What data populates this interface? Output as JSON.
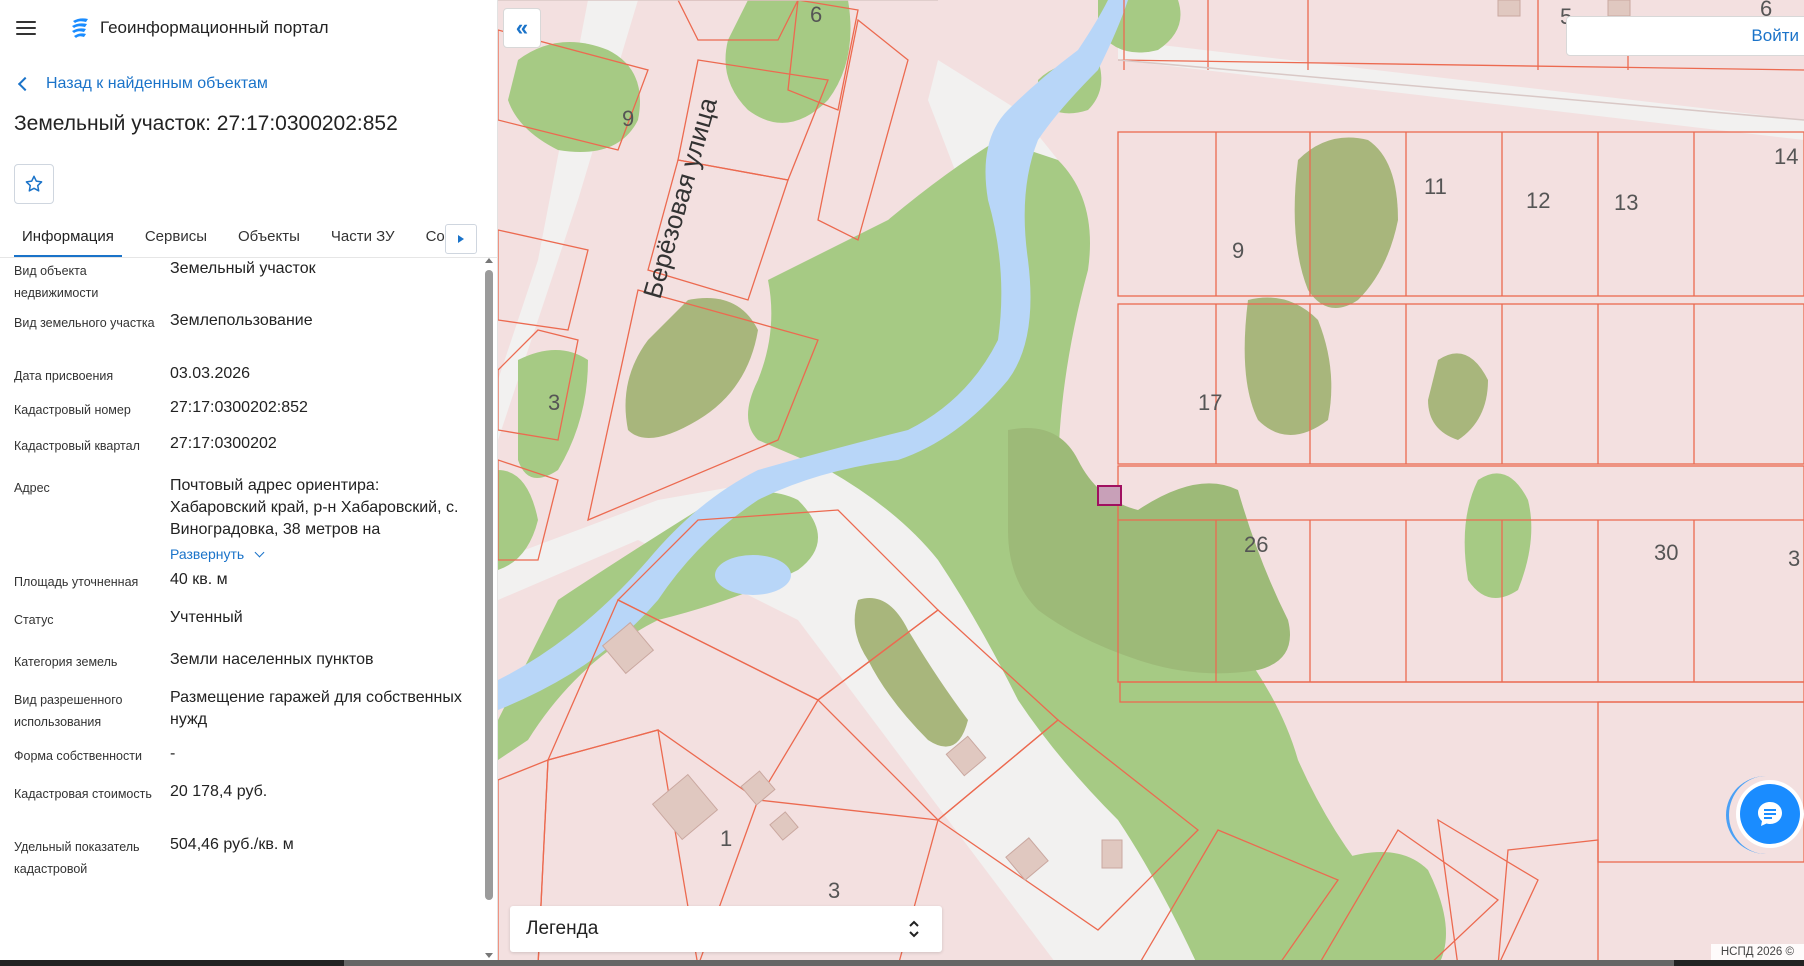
{
  "app": {
    "title": "Геоинформационный портал"
  },
  "panel": {
    "back_label": "Назад к найденным объектам",
    "object_title": "Земельный участок: 27:17:0300202:852",
    "tabs": [
      {
        "label": "Информация",
        "active": true
      },
      {
        "label": "Сервисы"
      },
      {
        "label": "Объекты"
      },
      {
        "label": "Части ЗУ"
      },
      {
        "label": "Состав"
      }
    ],
    "fields": [
      {
        "label": "Вид объекта недвижимости",
        "value": "Земельный участок"
      },
      {
        "label": "Вид земельного участка",
        "value": "Землепользование"
      },
      {
        "label": "Дата присвоения",
        "value": "03.03.2026"
      },
      {
        "label": "Кадастровый номер",
        "value": "27:17:0300202:852"
      },
      {
        "label": "Кадастровый квартал",
        "value": "27:17:0300202"
      },
      {
        "label": "Адрес",
        "value": "Почтовый адрес ориентира: Хабаровский край, р-н Хабаровский, с. Виноградовка, 38 метров на",
        "expand": "Развернуть"
      },
      {
        "label": "Площадь уточненная",
        "value": "40 кв. м"
      },
      {
        "label": "Статус",
        "value": "Учтенный"
      },
      {
        "label": "Категория земель",
        "value": "Земли населенных пунктов"
      },
      {
        "label": "Вид разрешенного использования",
        "value": "Размещение гаражей для собственных нужд"
      },
      {
        "label": "Форма собственности",
        "value": "-"
      },
      {
        "label": "Кадастровая стоимость",
        "value": "20 178,4 руб."
      },
      {
        "label": "Удельный показатель кадастровой",
        "value": "504,46 руб./кв. м"
      }
    ]
  },
  "map": {
    "login_label": "Войти",
    "legend_label": "Легенда",
    "street_label": "Берёзовая улица",
    "attribution": "НСПД 2026 ©",
    "parcel_numbers": [
      "6",
      "9",
      "3",
      "5",
      "6",
      "14",
      "11",
      "12",
      "13",
      "9",
      "17",
      "26",
      "30",
      "3",
      "1",
      "3"
    ],
    "colors": {
      "parcel_border": "#ec6a50",
      "vegetation": "#a6ca84",
      "water": "#b8d6f8",
      "land": "#f3e0e0",
      "road": "#f2f1f0",
      "building": "#e0c8c0",
      "selected_parcel": "#a01060",
      "accent": "#1a73c9"
    }
  }
}
